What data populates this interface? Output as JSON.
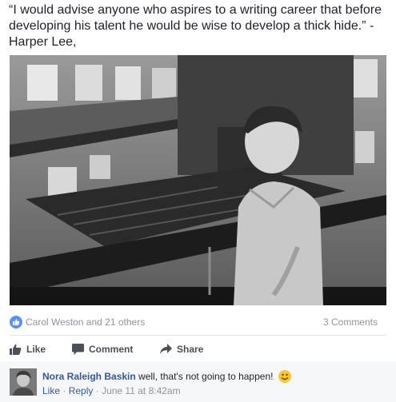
{
  "post": {
    "text": "“I would advise anyone who aspires to a writing career that before developing his talent he would be wise to develop a thick hide.” -Harper Lee,"
  },
  "reactions": {
    "names": "Carol Weston and 21 others",
    "comments": "3 Comments"
  },
  "actions": {
    "like": "Like",
    "comment": "Comment",
    "share": "Share"
  },
  "comment": {
    "author": "Nora Raleigh Baskin",
    "text": "well, that's not going to happen!",
    "like_link": "Like",
    "reply_link": "Reply",
    "separator": "·",
    "timestamp": "June 11 at 8:42am"
  },
  "colors": {
    "like_blue": "#5890ff",
    "link_blue": "#365899",
    "meta_gray": "#90949c",
    "action_gray": "#4b4f56",
    "emoji_yellow": "#f7c731"
  },
  "icons": [
    "thumbs-up-icon",
    "comment-icon",
    "share-arrow-icon",
    "smiley-emoji-icon"
  ]
}
